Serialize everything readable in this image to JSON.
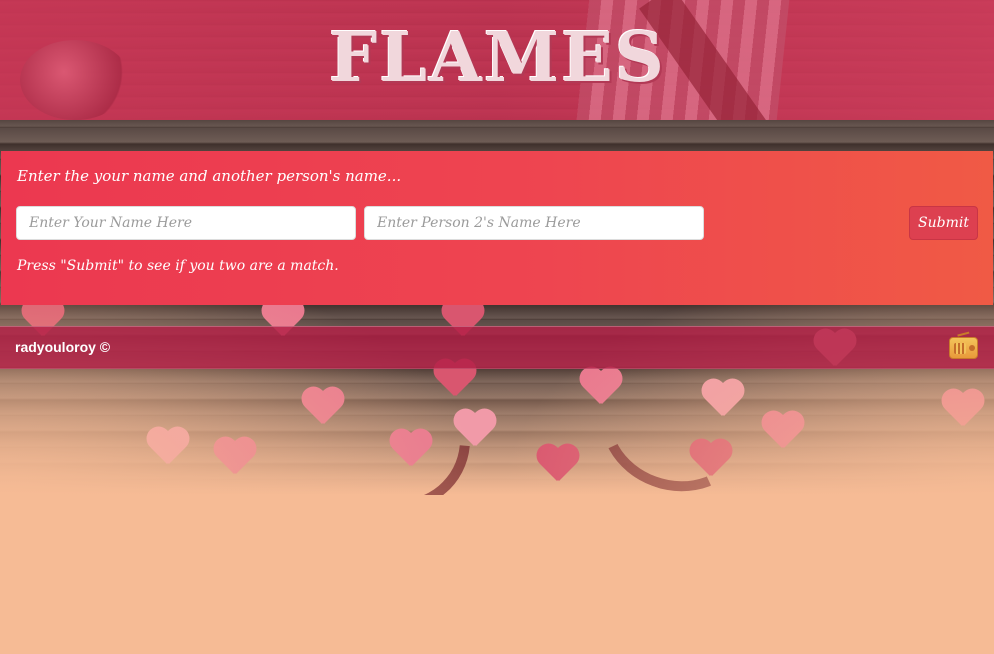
{
  "header": {
    "logo_text": "FLAMES"
  },
  "form": {
    "title": "Enter the your name and another person's name...",
    "name1_placeholder": "Enter Your Name Here",
    "name2_placeholder": "Enter Person 2's Name Here",
    "submit_label": "Submit",
    "hint": "Press \"Submit\" to see if you two are a match."
  },
  "footer": {
    "copyright": "radyouloroy ©",
    "radio_icon": "radio-icon"
  },
  "colors": {
    "page_background": "#f6bb95",
    "panel_gradient_start": "#ec3850",
    "panel_gradient_end": "#f05a45",
    "footer_background": "#b21e46",
    "submit_button": "#dd4050"
  }
}
